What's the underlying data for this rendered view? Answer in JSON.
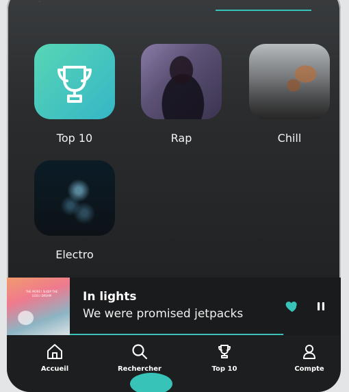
{
  "genres": [
    {
      "label": "Top 10"
    },
    {
      "label": "Rap"
    },
    {
      "label": "Chill"
    },
    {
      "label": "Electro"
    }
  ],
  "now_playing": {
    "title": "In lights",
    "artist": "We were promised jetpacks",
    "album_text": "THE MORE I SLEEP THE LESS I DREAM"
  },
  "bottom_nav": {
    "items": [
      {
        "label": "Accueil",
        "icon": "home-icon"
      },
      {
        "label": "Rechercher",
        "icon": "search-icon"
      },
      {
        "label": "Top 10",
        "icon": "trophy-icon"
      },
      {
        "label": "Compte",
        "icon": "user-icon"
      }
    ]
  },
  "colors": {
    "accent": "#37c3b7",
    "background": "#1b1c1d",
    "surface": "#1d1e1f"
  }
}
